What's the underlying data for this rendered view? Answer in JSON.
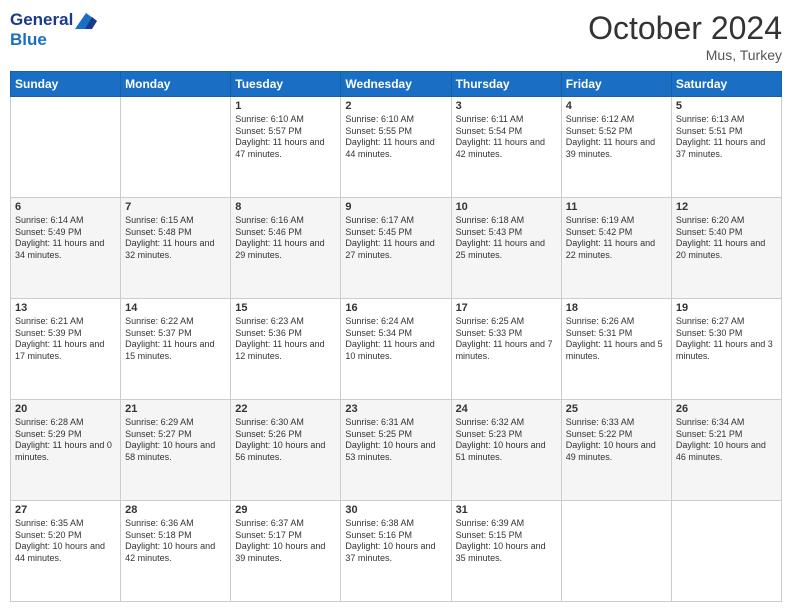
{
  "logo": {
    "line1": "General",
    "line2": "Blue"
  },
  "title": "October 2024",
  "location": "Mus, Turkey",
  "days_of_week": [
    "Sunday",
    "Monday",
    "Tuesday",
    "Wednesday",
    "Thursday",
    "Friday",
    "Saturday"
  ],
  "weeks": [
    [
      {
        "day": "",
        "data": ""
      },
      {
        "day": "",
        "data": ""
      },
      {
        "day": "1",
        "data": "Sunrise: 6:10 AM\nSunset: 5:57 PM\nDaylight: 11 hours and 47 minutes."
      },
      {
        "day": "2",
        "data": "Sunrise: 6:10 AM\nSunset: 5:55 PM\nDaylight: 11 hours and 44 minutes."
      },
      {
        "day": "3",
        "data": "Sunrise: 6:11 AM\nSunset: 5:54 PM\nDaylight: 11 hours and 42 minutes."
      },
      {
        "day": "4",
        "data": "Sunrise: 6:12 AM\nSunset: 5:52 PM\nDaylight: 11 hours and 39 minutes."
      },
      {
        "day": "5",
        "data": "Sunrise: 6:13 AM\nSunset: 5:51 PM\nDaylight: 11 hours and 37 minutes."
      }
    ],
    [
      {
        "day": "6",
        "data": "Sunrise: 6:14 AM\nSunset: 5:49 PM\nDaylight: 11 hours and 34 minutes."
      },
      {
        "day": "7",
        "data": "Sunrise: 6:15 AM\nSunset: 5:48 PM\nDaylight: 11 hours and 32 minutes."
      },
      {
        "day": "8",
        "data": "Sunrise: 6:16 AM\nSunset: 5:46 PM\nDaylight: 11 hours and 29 minutes."
      },
      {
        "day": "9",
        "data": "Sunrise: 6:17 AM\nSunset: 5:45 PM\nDaylight: 11 hours and 27 minutes."
      },
      {
        "day": "10",
        "data": "Sunrise: 6:18 AM\nSunset: 5:43 PM\nDaylight: 11 hours and 25 minutes."
      },
      {
        "day": "11",
        "data": "Sunrise: 6:19 AM\nSunset: 5:42 PM\nDaylight: 11 hours and 22 minutes."
      },
      {
        "day": "12",
        "data": "Sunrise: 6:20 AM\nSunset: 5:40 PM\nDaylight: 11 hours and 20 minutes."
      }
    ],
    [
      {
        "day": "13",
        "data": "Sunrise: 6:21 AM\nSunset: 5:39 PM\nDaylight: 11 hours and 17 minutes."
      },
      {
        "day": "14",
        "data": "Sunrise: 6:22 AM\nSunset: 5:37 PM\nDaylight: 11 hours and 15 minutes."
      },
      {
        "day": "15",
        "data": "Sunrise: 6:23 AM\nSunset: 5:36 PM\nDaylight: 11 hours and 12 minutes."
      },
      {
        "day": "16",
        "data": "Sunrise: 6:24 AM\nSunset: 5:34 PM\nDaylight: 11 hours and 10 minutes."
      },
      {
        "day": "17",
        "data": "Sunrise: 6:25 AM\nSunset: 5:33 PM\nDaylight: 11 hours and 7 minutes."
      },
      {
        "day": "18",
        "data": "Sunrise: 6:26 AM\nSunset: 5:31 PM\nDaylight: 11 hours and 5 minutes."
      },
      {
        "day": "19",
        "data": "Sunrise: 6:27 AM\nSunset: 5:30 PM\nDaylight: 11 hours and 3 minutes."
      }
    ],
    [
      {
        "day": "20",
        "data": "Sunrise: 6:28 AM\nSunset: 5:29 PM\nDaylight: 11 hours and 0 minutes."
      },
      {
        "day": "21",
        "data": "Sunrise: 6:29 AM\nSunset: 5:27 PM\nDaylight: 10 hours and 58 minutes."
      },
      {
        "day": "22",
        "data": "Sunrise: 6:30 AM\nSunset: 5:26 PM\nDaylight: 10 hours and 56 minutes."
      },
      {
        "day": "23",
        "data": "Sunrise: 6:31 AM\nSunset: 5:25 PM\nDaylight: 10 hours and 53 minutes."
      },
      {
        "day": "24",
        "data": "Sunrise: 6:32 AM\nSunset: 5:23 PM\nDaylight: 10 hours and 51 minutes."
      },
      {
        "day": "25",
        "data": "Sunrise: 6:33 AM\nSunset: 5:22 PM\nDaylight: 10 hours and 49 minutes."
      },
      {
        "day": "26",
        "data": "Sunrise: 6:34 AM\nSunset: 5:21 PM\nDaylight: 10 hours and 46 minutes."
      }
    ],
    [
      {
        "day": "27",
        "data": "Sunrise: 6:35 AM\nSunset: 5:20 PM\nDaylight: 10 hours and 44 minutes."
      },
      {
        "day": "28",
        "data": "Sunrise: 6:36 AM\nSunset: 5:18 PM\nDaylight: 10 hours and 42 minutes."
      },
      {
        "day": "29",
        "data": "Sunrise: 6:37 AM\nSunset: 5:17 PM\nDaylight: 10 hours and 39 minutes."
      },
      {
        "day": "30",
        "data": "Sunrise: 6:38 AM\nSunset: 5:16 PM\nDaylight: 10 hours and 37 minutes."
      },
      {
        "day": "31",
        "data": "Sunrise: 6:39 AM\nSunset: 5:15 PM\nDaylight: 10 hours and 35 minutes."
      },
      {
        "day": "",
        "data": ""
      },
      {
        "day": "",
        "data": ""
      }
    ]
  ]
}
